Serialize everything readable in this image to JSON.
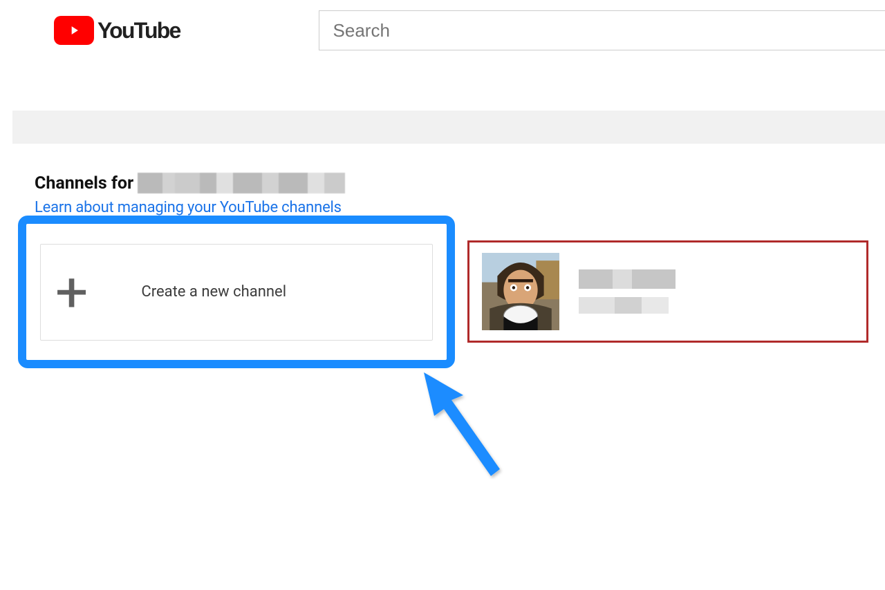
{
  "header": {
    "brand": "YouTube",
    "search_placeholder": "Search"
  },
  "page": {
    "heading_prefix": "Channels for",
    "learn_link": "Learn about managing your YouTube channels",
    "create_channel_label": "Create a new channel"
  },
  "colors": {
    "youtube_red": "#ff0000",
    "link_blue": "#1a73e8",
    "highlight_blue": "#1a8cff",
    "highlight_red": "#b02a2a"
  }
}
